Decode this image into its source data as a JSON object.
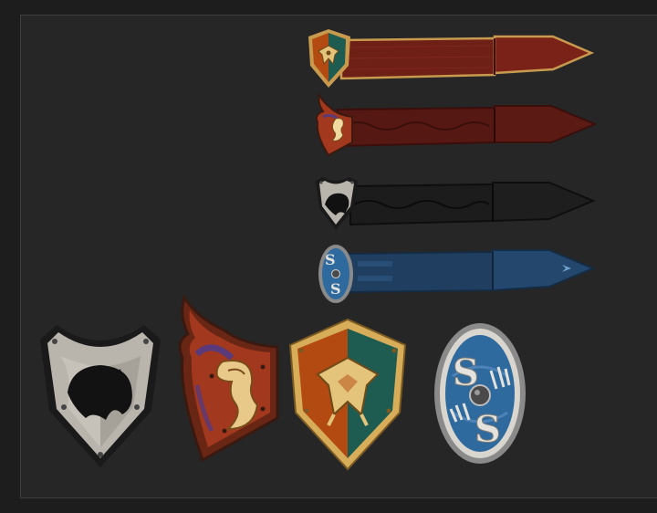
{
  "canvas": {
    "background": "#1d1d1d",
    "panel_background": "#262626",
    "panel_border": "#3e3e3e"
  },
  "banners": [
    {
      "id": "banner-dragon-heraldic",
      "emblem": "dragon-icon",
      "shield": "heater-quartered",
      "cloth_color": "#7a2218",
      "trim_color": "#c79a4e"
    },
    {
      "id": "banner-seahorse-red",
      "emblem": "seahorse-icon",
      "shield": "flame-kite",
      "cloth_color": "#5c1a14",
      "trim_color": "#3a0e0b"
    },
    {
      "id": "banner-panther-black",
      "emblem": "panther-icon",
      "shield": "steel-heater",
      "cloth_color": "#1e1e1e",
      "trim_color": "#111111"
    },
    {
      "id": "banner-serpent-blue",
      "emblem": "serpent-icon",
      "shield": "oval-boss",
      "cloth_color": "#24476e",
      "trim_color": "#6fa2cf"
    }
  ],
  "shields": [
    {
      "id": "shield-panther-steel",
      "emblem": "panther-icon",
      "colors": [
        "#b9b5ad",
        "#1a1a1a"
      ]
    },
    {
      "id": "shield-seahorse-flame",
      "emblem": "seahorse-icon",
      "colors": [
        "#a2381e",
        "#5a3a7a",
        "#e8c98a"
      ]
    },
    {
      "id": "shield-dragon-heater",
      "emblem": "dragon-icon",
      "colors": [
        "#b24a12",
        "#1e5c52",
        "#d7ad5a"
      ]
    },
    {
      "id": "shield-serpent-oval",
      "emblem": "serpent-icon",
      "colors": [
        "#2f6a9e",
        "#d9d6cf",
        "#8a8a8a"
      ]
    }
  ]
}
